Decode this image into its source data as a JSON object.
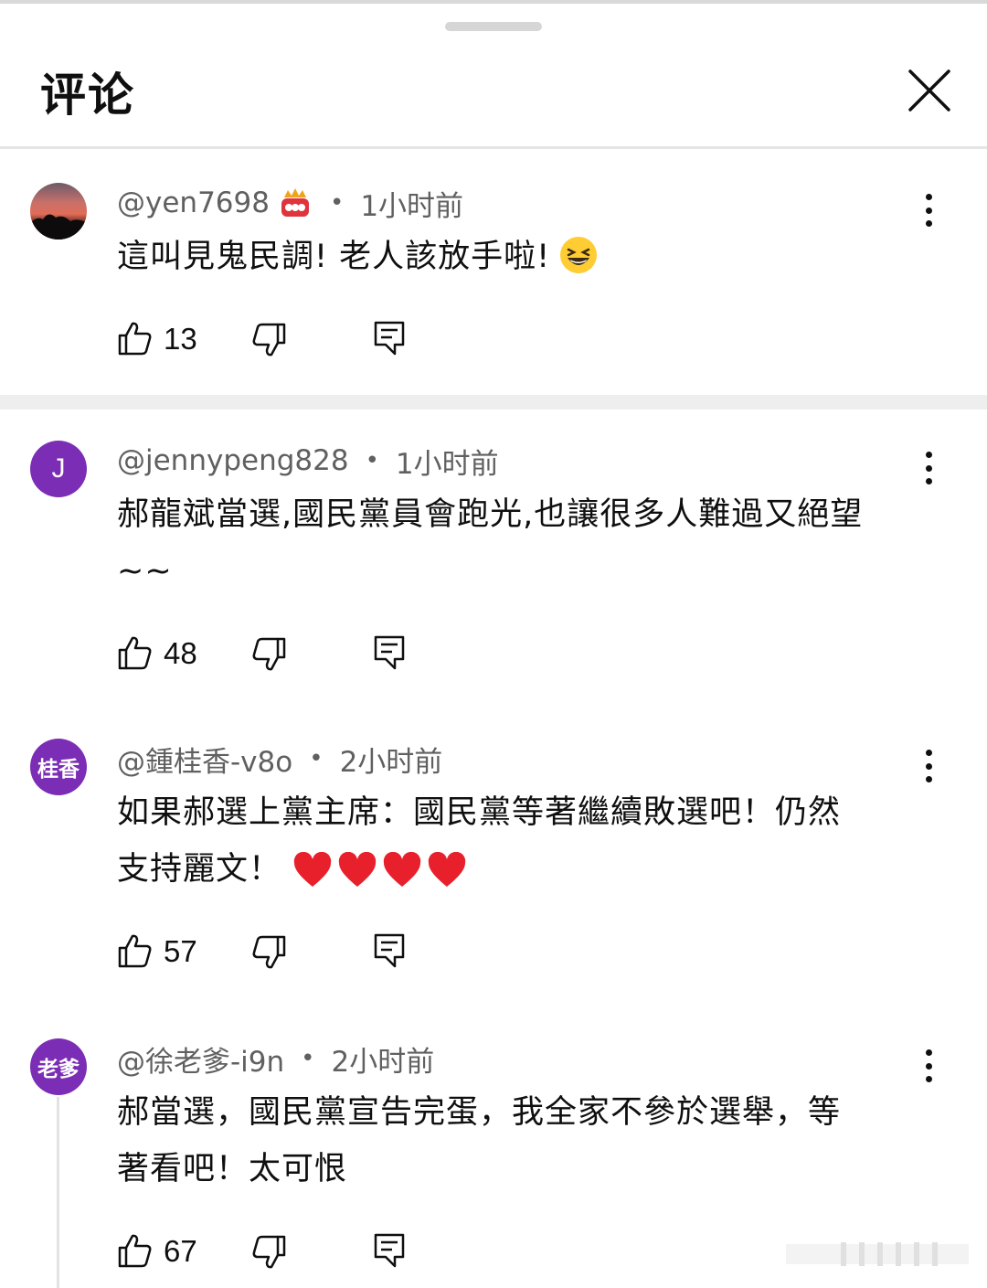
{
  "header": {
    "title": "评论"
  },
  "comments": [
    {
      "handle": "@yen7698",
      "time": "1小时前",
      "text": "這叫見鬼民調! 老人該放手啦!",
      "likes": "13",
      "avatar_color": "#c9706a"
    },
    {
      "handle": "@jennypeng828",
      "time": "1小时前",
      "text_line1": "郝龍斌當選,國民黨員會跑光,也讓很多人難過又絕望",
      "text_line2": "~~",
      "likes": "48",
      "avatar_letter": "J",
      "avatar_color": "#7b2db5"
    },
    {
      "handle": "@鍾桂香-v8o",
      "time": "2小时前",
      "text_line1": "如果郝選上黨主席：國民黨等著繼續敗選吧！仍然",
      "text_line2": "支持麗文！",
      "likes": "57",
      "avatar_chars": "桂香",
      "avatar_color": "#7b2db5"
    },
    {
      "handle": "@徐老爹-i9n",
      "time": "2小时前",
      "text_line1": "郝當選，國民黨宣告完蛋，我全家不參於選舉，等",
      "text_line2": "著看吧！太可恨",
      "likes": "67",
      "avatar_chars": "老爹",
      "avatar_color": "#7b2db5"
    }
  ],
  "colors": {
    "text": "#0f0f0f",
    "meta": "#606060",
    "avatar_purple": "#7b2db5",
    "divider": "#e5e5e5"
  },
  "icons": {
    "close": "close-icon",
    "more": "more-vertical-icon",
    "like": "thumbs-up-icon",
    "dislike": "thumbs-down-icon",
    "reply": "reply-comment-icon",
    "badge": "crown-badge-icon"
  }
}
